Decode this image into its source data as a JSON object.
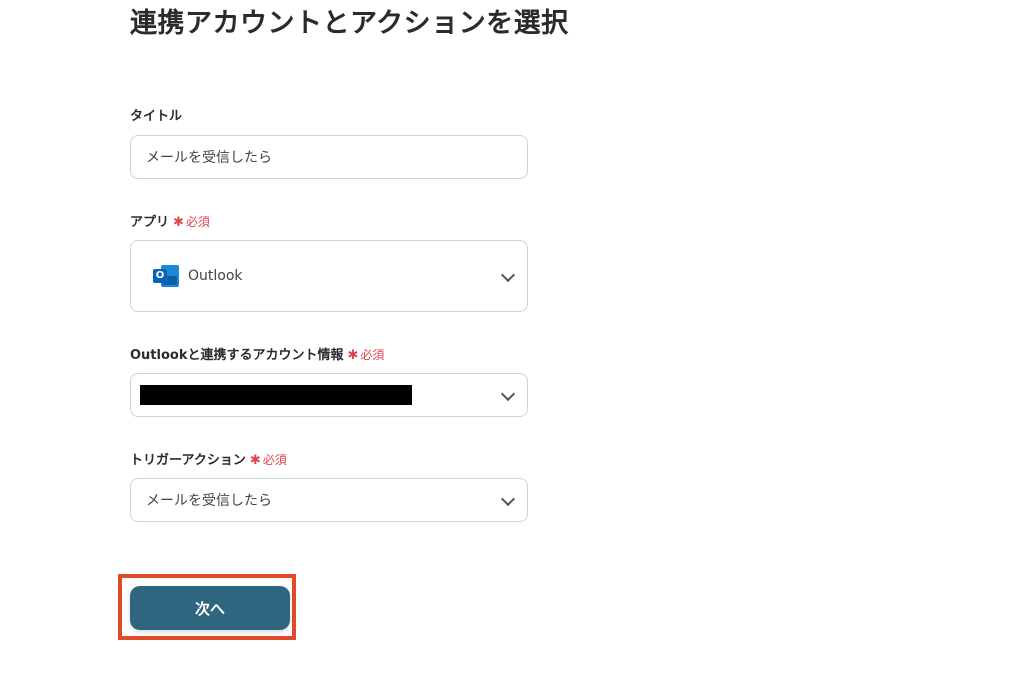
{
  "page": {
    "title": "連携アカウントとアクションを選択"
  },
  "required_label": "必須",
  "fields": {
    "title": {
      "label": "タイトル",
      "value": "メールを受信したら"
    },
    "app": {
      "label": "アプリ",
      "value": "Outlook",
      "icon": "outlook-icon"
    },
    "account": {
      "label": "Outlookと連携するアカウント情報"
    },
    "trigger": {
      "label": "トリガーアクション",
      "value": "メールを受信したら"
    }
  },
  "next_button": {
    "label": "次へ"
  },
  "colors": {
    "accent": "#2e6680",
    "required": "#e0454f",
    "highlight": "#e04a2a"
  }
}
